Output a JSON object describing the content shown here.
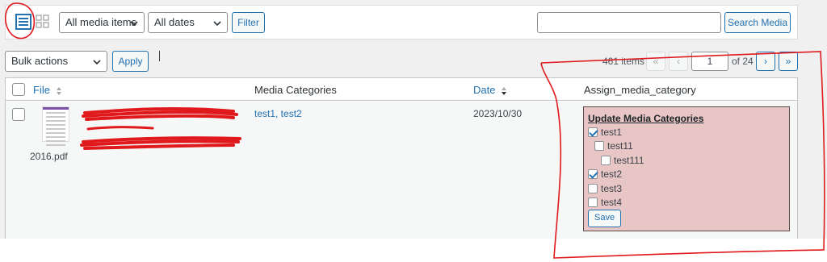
{
  "toolbar": {
    "media_filter": "All media items",
    "date_filter": "All dates",
    "filter_label": "Filter",
    "search_placeholder": "",
    "search_button": "Search Media"
  },
  "bulk": {
    "action": "Bulk actions",
    "apply_label": "Apply"
  },
  "pagination": {
    "count": "461 items",
    "first": "«",
    "prev": "‹",
    "current": "1",
    "of": "of 24",
    "next": "›",
    "last": "»"
  },
  "table": {
    "columns": {
      "file": "File",
      "media_categories": "Media Categories",
      "date": "Date",
      "assign": "Assign_media_category"
    },
    "row": {
      "filename": "2016.pdf",
      "categories": "test1, test2",
      "date": "2023/10/30"
    }
  },
  "assign_panel": {
    "title": "Update Media Categories",
    "options": [
      {
        "label": "test1",
        "checked": true
      },
      {
        "label": "test11",
        "checked": false
      },
      {
        "label": "test111",
        "checked": false
      },
      {
        "label": "test2",
        "checked": true
      },
      {
        "label": "test3",
        "checked": false
      },
      {
        "label": "test4",
        "checked": false
      }
    ],
    "save_label": "Save"
  },
  "colors": {
    "accent": "#2271b1",
    "panel_bg": "#e8c6c6",
    "annotation": "#e0191c"
  }
}
